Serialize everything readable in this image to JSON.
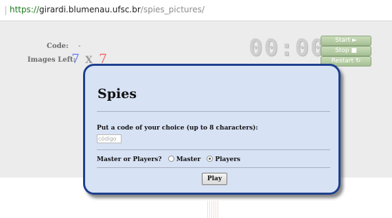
{
  "browser": {
    "url_scheme": "https://",
    "url_host": "girardi.blumenau.ufsc.br",
    "url_path": "/spies_pictures/"
  },
  "game": {
    "code_label": "Code:",
    "code_value": "-",
    "images_left_label": "Images Left:",
    "grid_cols": "7",
    "grid_sep": "X",
    "grid_rows": "7",
    "timer": "00:00",
    "start_label": "Start ►",
    "stop_label": "Stop ■",
    "restart_label": "Restart ↻"
  },
  "modal": {
    "title": "Spies",
    "code_prompt": "Put a code of your choice (up to 8 characters):",
    "code_placeholder": "código",
    "role_question": "Master or Players?",
    "role_options": [
      "Master",
      "Players"
    ],
    "role_selected": "Players",
    "play_label": "Play"
  },
  "colors": {
    "accent_blue": "#6f84f0",
    "accent_red": "#ef6a6a",
    "modal_border": "#1d3f8e",
    "modal_bg": "#d7e2f4",
    "button_green": "#a6bf94"
  }
}
